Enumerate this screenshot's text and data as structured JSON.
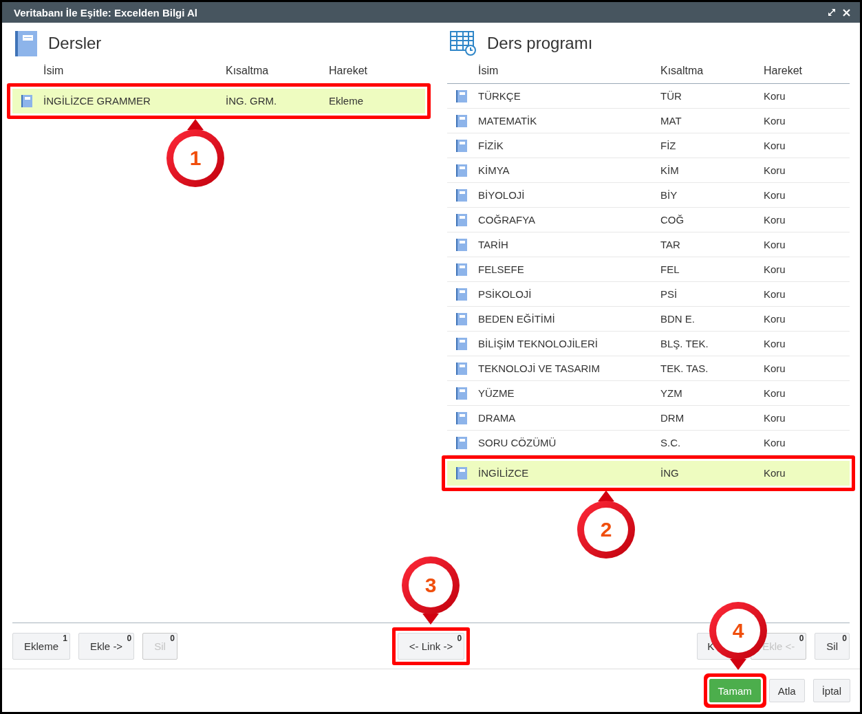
{
  "window": {
    "title": "Veritabanı İle Eşitle: Excelden Bilgi Al"
  },
  "panels": [
    {
      "title": "Dersler",
      "columns": [
        "İsim",
        "Kısaltma",
        "Hareket"
      ],
      "rows": [
        {
          "name": "İNGİLİZCE GRAMMER",
          "short": "İNG. GRM.",
          "action": "Ekleme",
          "selected": true,
          "highlighted": true
        }
      ]
    },
    {
      "title": "Ders programı",
      "columns": [
        "İsim",
        "Kısaltma",
        "Hareket"
      ],
      "rows": [
        {
          "name": "TÜRKÇE",
          "short": "TÜR",
          "action": "Koru",
          "selected": false,
          "highlighted": false
        },
        {
          "name": "MATEMATİK",
          "short": "MAT",
          "action": "Koru",
          "selected": false,
          "highlighted": false
        },
        {
          "name": "FİZİK",
          "short": "FİZ",
          "action": "Koru",
          "selected": false,
          "highlighted": false
        },
        {
          "name": "KİMYA",
          "short": "KİM",
          "action": "Koru",
          "selected": false,
          "highlighted": false
        },
        {
          "name": "BİYOLOJİ",
          "short": "BİY",
          "action": "Koru",
          "selected": false,
          "highlighted": false
        },
        {
          "name": "COĞRAFYA",
          "short": "COĞ",
          "action": "Koru",
          "selected": false,
          "highlighted": false
        },
        {
          "name": "TARİH",
          "short": "TAR",
          "action": "Koru",
          "selected": false,
          "highlighted": false
        },
        {
          "name": "FELSEFE",
          "short": "FEL",
          "action": "Koru",
          "selected": false,
          "highlighted": false
        },
        {
          "name": "PSİKOLOJİ",
          "short": "PSİ",
          "action": "Koru",
          "selected": false,
          "highlighted": false
        },
        {
          "name": "BEDEN EĞİTİMİ",
          "short": "BDN E.",
          "action": "Koru",
          "selected": false,
          "highlighted": false
        },
        {
          "name": "BİLİŞİM TEKNOLOJİLERİ",
          "short": "BLŞ. TEK.",
          "action": "Koru",
          "selected": false,
          "highlighted": false
        },
        {
          "name": "TEKNOLOJİ VE TASARIM",
          "short": "TEK. TAS.",
          "action": "Koru",
          "selected": false,
          "highlighted": false
        },
        {
          "name": "YÜZME",
          "short": "YZM",
          "action": "Koru",
          "selected": false,
          "highlighted": false
        },
        {
          "name": "DRAMA",
          "short": "DRM",
          "action": "Koru",
          "selected": false,
          "highlighted": false
        },
        {
          "name": "SORU CÖZÜMÜ",
          "short": "S.C.",
          "action": "Koru",
          "selected": false,
          "highlighted": false
        },
        {
          "name": "İNGİLİZCE",
          "short": "İNG",
          "action": "Koru",
          "selected": true,
          "highlighted": true
        }
      ]
    }
  ],
  "toolbar": {
    "left": [
      {
        "label": "Ekleme",
        "count": "1",
        "disabled": false
      },
      {
        "label": "Ekle ->",
        "count": "0",
        "disabled": false
      },
      {
        "label": "Sil",
        "count": "0",
        "disabled": true
      }
    ],
    "center": [
      {
        "label": "<- Link ->",
        "count": "0",
        "disabled": false,
        "highlighted": true
      }
    ],
    "right": [
      {
        "label": "K",
        "disabled": false
      },
      {
        "label": "Ekle <-",
        "count": "0",
        "disabled": true
      },
      {
        "label": "Sil",
        "count": "0",
        "disabled": false
      }
    ]
  },
  "footer": {
    "buttons": [
      {
        "label": "Tamam",
        "kind": "primary",
        "highlighted": true
      },
      {
        "label": "Atla",
        "kind": "default",
        "highlighted": false
      },
      {
        "label": "İptal",
        "kind": "default",
        "highlighted": false
      }
    ]
  },
  "callouts": [
    {
      "number": "1"
    },
    {
      "number": "2"
    },
    {
      "number": "3"
    },
    {
      "number": "4"
    }
  ]
}
